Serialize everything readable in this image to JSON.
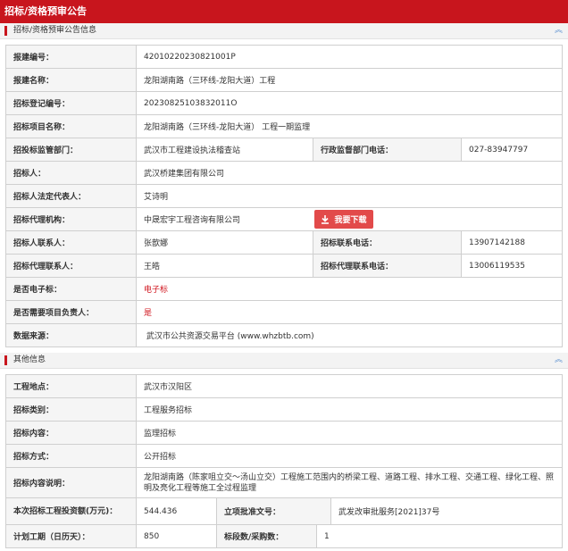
{
  "page_title": "招标/资格预审公告",
  "section1": {
    "title": "招标/资格预审公告信息",
    "rows": [
      {
        "label": "报建编号：",
        "value": "42010220230821001P"
      },
      {
        "label": "报建名称：",
        "value": "龙阳湖南路（三环线-龙阳大道）工程"
      },
      {
        "label": "招标登记编号：",
        "value": "20230825103832011O"
      },
      {
        "label": "招标项目名称：",
        "value": "龙阳湖南路（三环线-龙阳大道） 工程一期监理"
      },
      {
        "label": "招投标监管部门：",
        "value": "武汉市工程建设执法稽查站",
        "label2": "行政监督部门电话：",
        "value2": "027-83947797"
      },
      {
        "label": "招标人：",
        "value": "武汉桥建集团有限公司"
      },
      {
        "label": "招标人法定代表人：",
        "value": "艾诗明"
      },
      {
        "label": "招标代理机构：",
        "value": "中晟宏宇工程咨询有限公司",
        "button": "我要下载"
      },
      {
        "label": "招标人联系人：",
        "value": "张歆娜",
        "label2": "招标联系电话：",
        "value2": "13907142188"
      },
      {
        "label": "招标代理联系人：",
        "value": "王皓",
        "label2": "招标代理联系电话：",
        "value2": "13006119535"
      },
      {
        "label": "是否电子标：",
        "value": "电子标"
      },
      {
        "label": "是否需要项目负责人：",
        "value": "是"
      },
      {
        "label": "数据来源：",
        "value": " 武汉市公共资源交易平台 (www.whzbtb.com)"
      }
    ]
  },
  "section2": {
    "title": "其他信息",
    "rows": [
      {
        "label": "工程地点：",
        "value": "武汉市汉阳区"
      },
      {
        "label": "招标类别：",
        "value": "工程服务招标"
      },
      {
        "label": "招标内容：",
        "value": "监理招标"
      },
      {
        "label": "招标方式：",
        "value": "公开招标"
      },
      {
        "label": "招标内容说明：",
        "value": "龙阳湖南路（陈家咀立交～汤山立交）工程施工范围内的桥梁工程、道路工程、排水工程、交通工程、绿化工程、照明及亮化工程等施工全过程监理"
      },
      {
        "label": "本次招标工程投资额(万元)：",
        "value": "544.436",
        "label2": "立项批准文号：",
        "value2": "武发改审批服务[2021]37号"
      },
      {
        "label": "计划工期（日历天）：",
        "value": "850",
        "label2": "标段数/采购数：",
        "value2": "1"
      }
    ]
  },
  "icons": {
    "collapse": "chevron-up-icon",
    "download": "download-icon"
  },
  "colors": {
    "brand": "#c8151d",
    "button": "#e24a4a",
    "label_bg": "#f5f5f5"
  }
}
